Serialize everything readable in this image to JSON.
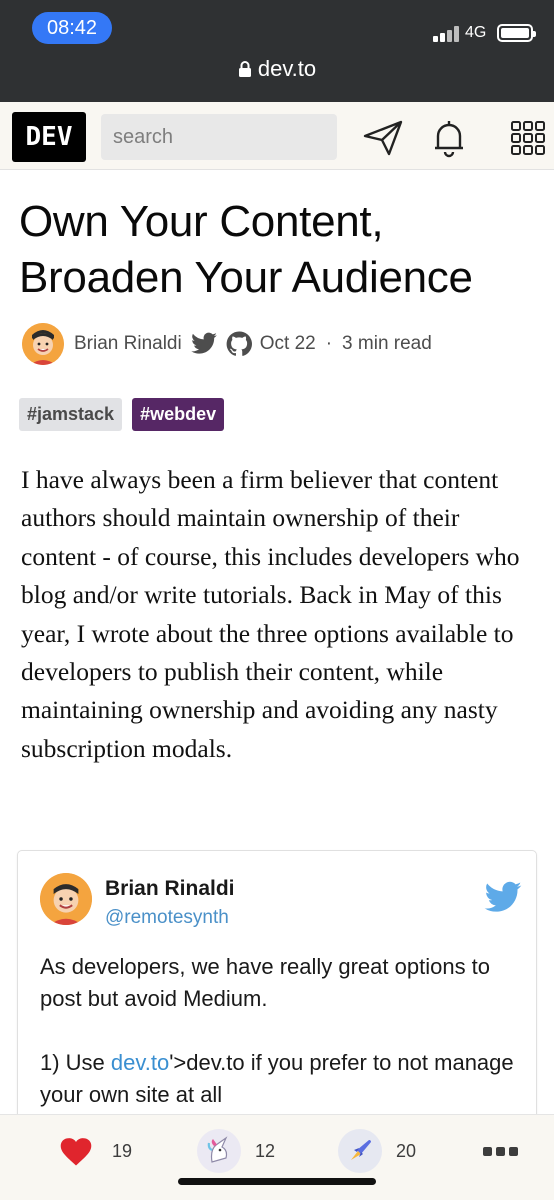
{
  "status_bar": {
    "time": "08:42",
    "network": "4G"
  },
  "browser": {
    "url": "dev.to"
  },
  "header": {
    "logo": "DEV",
    "search_placeholder": "search"
  },
  "article": {
    "title": "Own Your Content, Broaden Your Audience",
    "author": "Brian Rinaldi",
    "date": "Oct 22",
    "separator": "·",
    "read_time": "3 min read",
    "tags": [
      "#jamstack",
      "#webdev"
    ],
    "body": "I have always been a firm believer that content authors should maintain ownership of their content - of course, this includes developers who blog and/or write tutorials. Back in May of this year, I wrote about the three options available to developers to publish their content, while maintaining ownership and avoiding any nasty subscription modals."
  },
  "tweet": {
    "name": "Brian Rinaldi",
    "handle": "@remotesynth",
    "line1": "As developers, we have really great options to post but avoid Medium.",
    "line2_prefix": "1) Use ",
    "line2_link": "dev.to",
    "line2_suffix": "'>dev.to if you prefer to not manage your own site at all"
  },
  "reactions": {
    "hearts": "19",
    "unicorns": "12",
    "bookmarks": "20"
  },
  "colors": {
    "tag_webdev": "#562765",
    "heart": "#e0252d",
    "link": "#3a8fd1",
    "time_pill": "#3478f6"
  }
}
